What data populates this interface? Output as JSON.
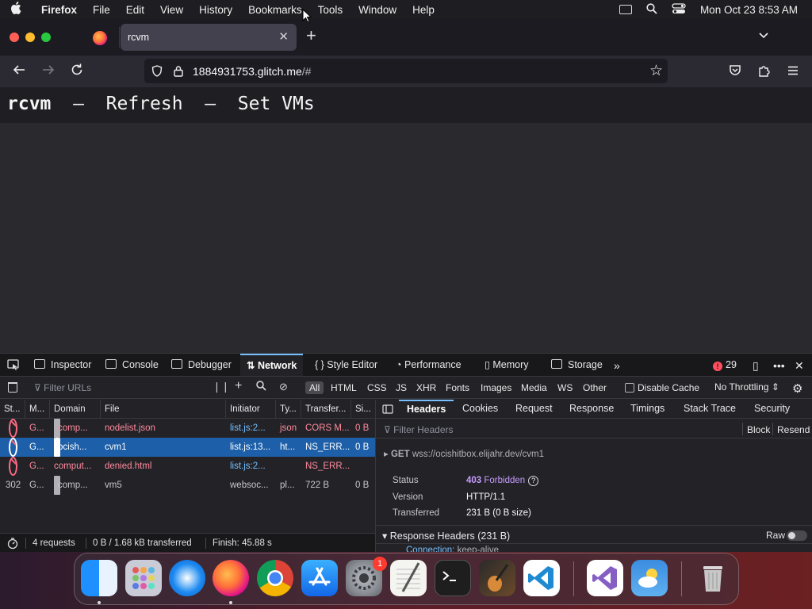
{
  "menubar": {
    "app": "Firefox",
    "items": [
      "File",
      "Edit",
      "View",
      "History",
      "Bookmarks",
      "Tools",
      "Window",
      "Help"
    ],
    "datetime": "Mon Oct 23  8:53 AM"
  },
  "browser": {
    "tab_title": "rcvm",
    "url_host": "1884931753.glitch.me",
    "url_path": "/#"
  },
  "page": {
    "title_bold": "rcvm",
    "title_rest": "  –  Refresh  –  Set VMs"
  },
  "devtools": {
    "tabs": [
      "Inspector",
      "Console",
      "Debugger",
      "Network",
      "Style Editor",
      "Performance",
      "Memory",
      "Storage"
    ],
    "active_tab": "Network",
    "error_count": "29",
    "filter_placeholder": "Filter URLs",
    "type_filters": [
      "All",
      "HTML",
      "CSS",
      "JS",
      "XHR",
      "Fonts",
      "Images",
      "Media",
      "WS",
      "Other"
    ],
    "disable_cache": "Disable Cache",
    "throttling": "No Throttling ⇕",
    "columns": [
      "St...",
      "M...",
      "Domain",
      "File",
      "Initiator",
      "Ty...",
      "Transfer...",
      "Si..."
    ],
    "requests": [
      {
        "status": "",
        "method": "G...",
        "domain": "comp...",
        "file": "nodelist.json",
        "initiator": "list.js:2...",
        "type": "json",
        "transfer": "CORS M...",
        "size": "0 B",
        "state": "err"
      },
      {
        "status": "",
        "method": "G...",
        "domain": "ocish...",
        "file": "cvm1",
        "initiator": "list.js:13...",
        "type": "ht...",
        "transfer": "NS_ERR...",
        "size": "0 B",
        "state": "sel"
      },
      {
        "status": "",
        "method": "G...",
        "domain": "comput...",
        "file": "denied.html",
        "initiator": "list.js:2...",
        "type": "",
        "transfer": "NS_ERR...",
        "size": "",
        "state": "err"
      },
      {
        "status": "302",
        "method": "G...",
        "domain": "comp...",
        "file": "vm5",
        "initiator": "websoc...",
        "type": "pl...",
        "transfer": "722 B",
        "size": "0 B",
        "state": "plain"
      }
    ],
    "status_bar": {
      "requests": "4 requests",
      "transferred": "0 B / 1.68 kB transferred",
      "finish": "Finish: 45.88 s"
    },
    "panel_tabs": [
      "Headers",
      "Cookies",
      "Request",
      "Response",
      "Timings",
      "Stack Trace",
      "Security"
    ],
    "panel_active": "Headers",
    "filter_headers": "Filter Headers",
    "block_label": "Block",
    "resend_label": "Resend",
    "request_line": {
      "method": "GET",
      "url": "wss://ocishitbox.elijahr.dev/cvm1"
    },
    "summary": [
      {
        "key": "Status",
        "code": "403",
        "value": "Forbidden"
      },
      {
        "key": "Version",
        "code": "",
        "value": "HTTP/1.1"
      },
      {
        "key": "Transferred",
        "code": "",
        "value": "231 B (0 B size)"
      }
    ],
    "response_headers_label": "Response Headers (231 B)",
    "raw_label": "Raw",
    "first_header": {
      "name": "Connection:",
      "value": "keep-alive"
    }
  },
  "dock": {
    "apps": [
      "Finder",
      "Launchpad",
      "Safari",
      "Firefox",
      "Chrome",
      "App Store",
      "System Settings",
      "TextEdit",
      "Terminal",
      "GarageBand",
      "Visual Studio Code",
      "Visual Studio",
      "Weather",
      "Trash"
    ],
    "settings_badge": "1"
  }
}
